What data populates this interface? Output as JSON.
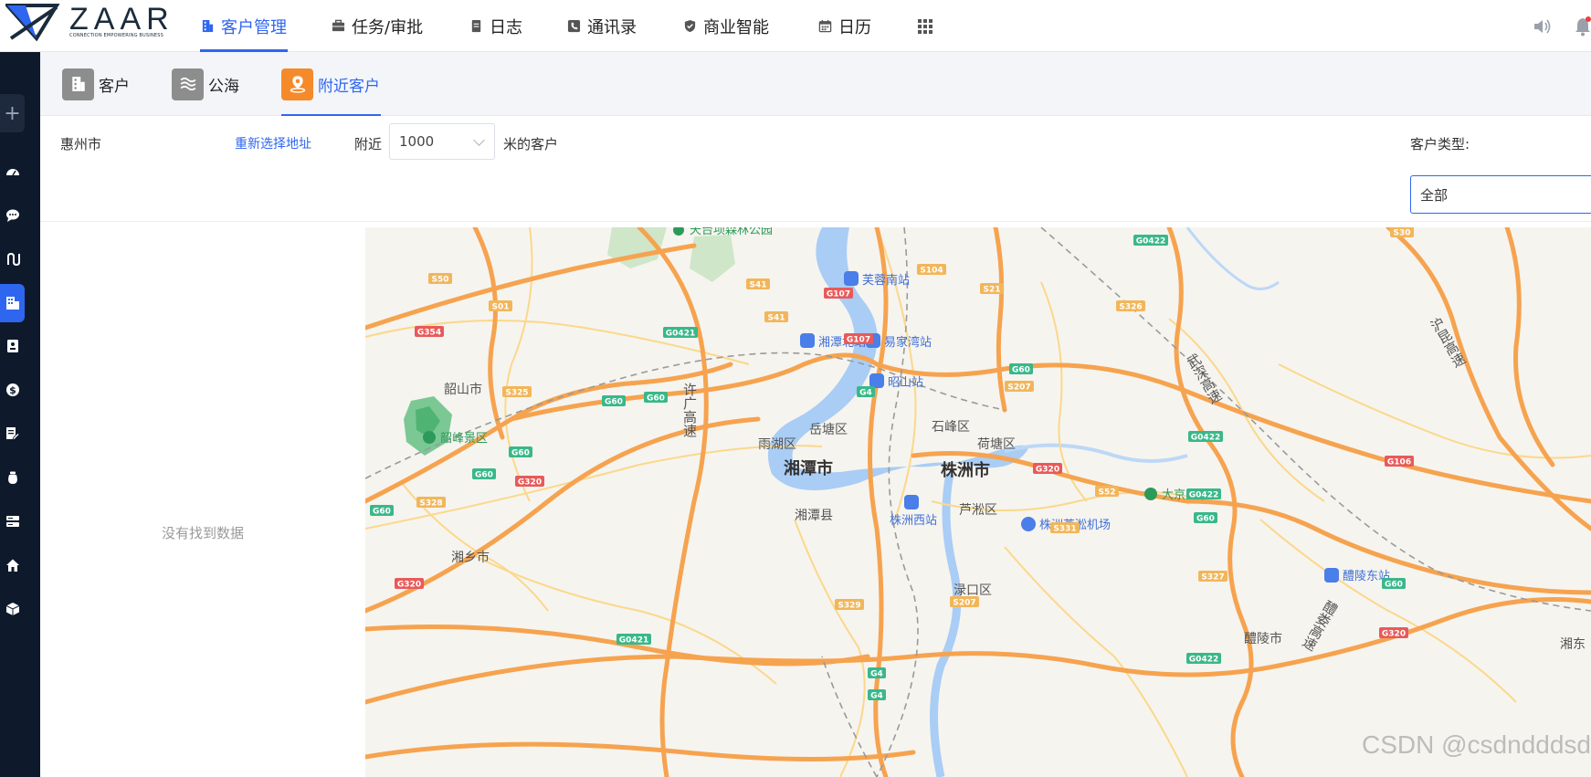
{
  "brand": {
    "name": "ZAAR",
    "tagline": "CONNECTION EMPOWERING BUSINESS"
  },
  "nav": {
    "items": [
      {
        "label": "客户管理",
        "icon": "building-icon",
        "active": true
      },
      {
        "label": "任务/审批",
        "icon": "briefcase-icon",
        "active": false
      },
      {
        "label": "日志",
        "icon": "document-icon",
        "active": false
      },
      {
        "label": "通讯录",
        "icon": "phone-book-icon",
        "active": false
      },
      {
        "label": "商业智能",
        "icon": "shield-check-icon",
        "active": false
      },
      {
        "label": "日历",
        "icon": "calendar-icon",
        "active": false
      }
    ],
    "apps_icon": "apps-grid-icon",
    "right_icons": [
      "speaker-icon",
      "bell-icon"
    ]
  },
  "rail": {
    "add_label": "+",
    "icons": [
      "dashboard-icon",
      "chat-icon",
      "flow-icon",
      "customer-icon",
      "contact-card-icon",
      "money-icon",
      "document-edit-icon",
      "bag-icon",
      "server-icon",
      "home-icon",
      "cube-icon"
    ],
    "active_index": 3
  },
  "subtabs": [
    {
      "label": "客户",
      "icon": "building-icon",
      "color": "#8d8d8d",
      "active": false
    },
    {
      "label": "公海",
      "icon": "waves-icon",
      "color": "#8d8d8d",
      "active": false
    },
    {
      "label": "附近客户",
      "icon": "map-pin-icon",
      "color": "#f58a2a",
      "active": true
    }
  ],
  "filters": {
    "city": "惠州市",
    "reselect_label": "重新选择地址",
    "near_label": "附近",
    "distance_value": "1000",
    "near_suffix": "米的客户",
    "type_label": "客户类型:",
    "type_value": "全部"
  },
  "list": {
    "empty_text": "没有找到数据"
  },
  "map": {
    "cities": [
      "湘潭市",
      "株洲市"
    ],
    "districts": [
      "韶山市",
      "岳塘区",
      "雨湖区",
      "石峰区",
      "荷塘区",
      "湘潭县",
      "芦淞区",
      "湘乡市",
      "渌口区",
      "醴陵市",
      "湘东"
    ],
    "pois": [
      "芙蓉南站",
      "湘潭北站",
      "易家湾站",
      "昭山站",
      "株洲西站",
      "株洲芦淞机场",
      "醴陵东站"
    ],
    "parks": [
      "韶峰景区",
      "大京风景区",
      "天台项森林公园"
    ],
    "highway_names": [
      "许广高速",
      "武深高速",
      "沪昆高速",
      "醴娄高速"
    ],
    "shields": [
      "S50",
      "S01",
      "G354",
      "S325",
      "G60",
      "G60",
      "G60",
      "G60",
      "G0421",
      "S41",
      "S41",
      "G107",
      "G107",
      "S104",
      "S21",
      "G4",
      "G60",
      "S207",
      "G0422",
      "S326",
      "S30",
      "G0422",
      "G106",
      "G0422",
      "G60",
      "S52",
      "S331",
      "G320",
      "S327",
      "G60",
      "G320",
      "S328",
      "G60",
      "G320",
      "G320",
      "S329",
      "S207",
      "G4",
      "G0421",
      "G4",
      "G0422"
    ]
  },
  "watermark": "CSDN @csdndddsd",
  "colors": {
    "accent": "#2f66f0",
    "rail_bg": "#0e1a2b",
    "highway": "#f6a34f",
    "water": "#a9cdf5"
  }
}
